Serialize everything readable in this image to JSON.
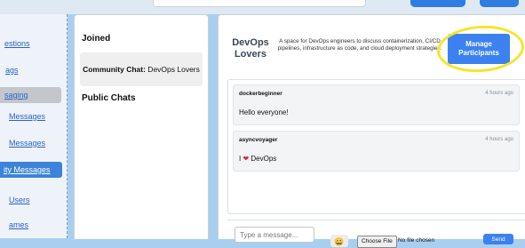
{
  "sidebar": {
    "items": [
      {
        "label": "estions"
      },
      {
        "label": "ags"
      },
      {
        "label": "saging"
      },
      {
        "label": "Messages"
      },
      {
        "label": "Messages"
      },
      {
        "label": "ity Messages"
      },
      {
        "label": "Users"
      },
      {
        "label": "ames"
      }
    ]
  },
  "joined": {
    "heading": "Joined",
    "room_prefix": "Community Chat:",
    "room_name": " DevOps Lovers",
    "public_heading": "Public Chats"
  },
  "chat": {
    "title_line1": "DevOps",
    "title_line2": "Lovers",
    "description": "A space for DevOps engineers to discuss containerization, CI/CD pipelines, infrastructure as code, and cloud deployment strategies.",
    "manage_line1": "Manage",
    "manage_line2": "Participants",
    "messages": [
      {
        "user": "dockerbeginner",
        "time": "4 hours ago",
        "text": "Hello everyone!"
      },
      {
        "user": "asyncvoyager",
        "time": "4 hours ago",
        "text_prefix": "I",
        "heart": "❤",
        "text_suffix": "DevOps"
      }
    ],
    "composer": {
      "placeholder": "Type a message...",
      "emoji": "😀",
      "file_button": "Choose File",
      "file_status": "No file chosen",
      "send": "Send"
    }
  },
  "colors": {
    "accent": "#3b82f0",
    "highlight": "#f7e42a",
    "page_bg": "#a9cff0"
  }
}
